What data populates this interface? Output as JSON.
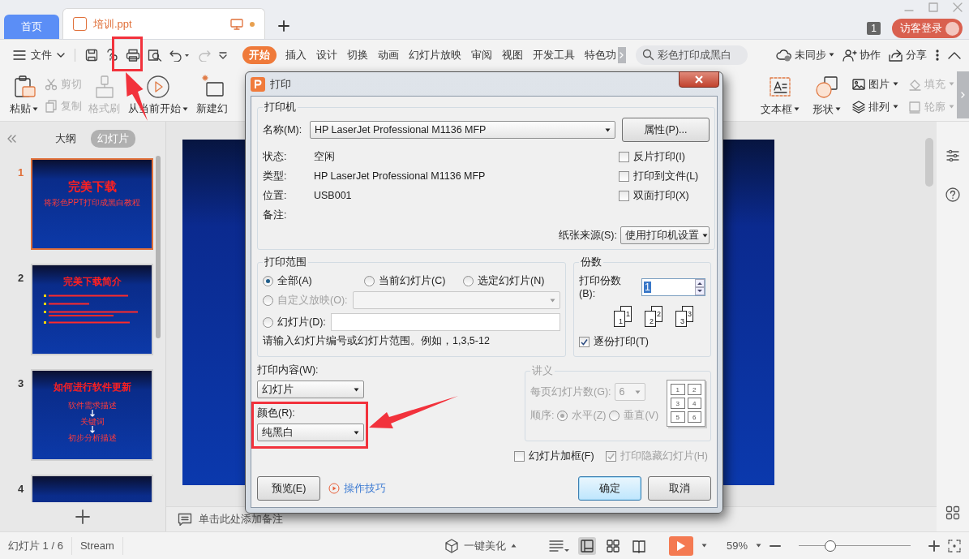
{
  "app_tabs": [
    {
      "label": "首页",
      "selected": false
    },
    {
      "label": "培训.ppt",
      "selected": true,
      "unsaved": true
    }
  ],
  "account": {
    "badge": "1",
    "login": "访客登录"
  },
  "file_menu": "文件",
  "ribbon_tabs": [
    {
      "label": "开始",
      "selected": true
    },
    {
      "label": "插入",
      "selected": false
    },
    {
      "label": "设计",
      "selected": false
    },
    {
      "label": "切换",
      "selected": false
    },
    {
      "label": "动画",
      "selected": false
    },
    {
      "label": "幻灯片放映",
      "selected": false
    },
    {
      "label": "审阅",
      "selected": false
    },
    {
      "label": "视图",
      "selected": false
    },
    {
      "label": "开发工具",
      "selected": false
    },
    {
      "label": "特色功",
      "selected": false
    }
  ],
  "search": {
    "placeholder": "彩色打印成黑白"
  },
  "top_actions": [
    {
      "label": "未同步",
      "kind": "cloud"
    },
    {
      "label": "协作",
      "kind": "person"
    },
    {
      "label": "分享",
      "kind": "share"
    }
  ],
  "ribbon_left": [
    {
      "label": "粘贴",
      "kind": "paste",
      "dropdown": true,
      "disabled": false
    },
    {
      "label": "剪切",
      "kind": "cut",
      "dropdown": false,
      "disabled": true
    },
    {
      "label": "复制",
      "kind": "copy",
      "dropdown": false,
      "disabled": true
    },
    {
      "label": "格式刷",
      "kind": "brush",
      "dropdown": false,
      "disabled": true
    },
    {
      "label": "从当前开始",
      "kind": "play",
      "dropdown": true,
      "disabled": false
    },
    {
      "label": "新建幻",
      "kind": "new",
      "dropdown": false,
      "disabled": false
    }
  ],
  "ribbon_right": [
    {
      "label": "文本框",
      "kind": "textbox",
      "dropdown": true,
      "disabled": false
    },
    {
      "label": "形状",
      "kind": "shape",
      "dropdown": true,
      "disabled": false
    },
    {
      "label": "图片",
      "kind": "picture",
      "dropdown": true,
      "disabled": false
    },
    {
      "label": "排列",
      "kind": "arrange",
      "dropdown": true,
      "disabled": false
    },
    {
      "label": "填充",
      "kind": "fill",
      "dropdown": true,
      "disabled": true
    },
    {
      "label": "轮廓",
      "kind": "outline",
      "dropdown": true,
      "disabled": true
    }
  ],
  "panel_tabs": [
    {
      "label": "大纲",
      "selected": false
    },
    {
      "label": "幻灯片",
      "selected": true
    }
  ],
  "slides": [
    {
      "number": "1",
      "selected": true,
      "kind": "title",
      "title": "完美下载",
      "lines": [
        "将彩色PPT打印成黑白教程"
      ]
    },
    {
      "number": "2",
      "selected": false,
      "kind": "bullets",
      "title": "完美下载简介"
    },
    {
      "number": "3",
      "selected": false,
      "kind": "flow",
      "title": "如何进行软件更新",
      "lines": [
        "软件需求描述",
        "关键词",
        "初步分析描述"
      ]
    },
    {
      "number": "4",
      "selected": false,
      "kind": "blank"
    }
  ],
  "notes": {
    "placeholder": "单击此处添加备注"
  },
  "status_bar": {
    "slide_info": "幻灯片 1 / 6",
    "theme": "Stream",
    "beautify": "一键美化",
    "zoom": "59%",
    "zoom_slider": {
      "level": 0.28
    },
    "views": [
      {
        "kind": "normal",
        "selected": true
      },
      {
        "kind": "sorter",
        "selected": false
      },
      {
        "kind": "reading",
        "selected": false
      }
    ]
  },
  "dialog": {
    "title": "打印",
    "printer": {
      "legend": "打印机",
      "name_label": "名称(M):",
      "name": "HP LaserJet Professional M1136 MFP",
      "properties_button": "属性(P)...",
      "info": [
        {
          "label": "状态:",
          "value": "空闲"
        },
        {
          "label": "类型:",
          "value": "HP LaserJet Professional M1136 MFP"
        },
        {
          "label": "位置:",
          "value": "USB001"
        },
        {
          "label": "备注:"
        }
      ],
      "options": [
        {
          "label": "反片打印(I)",
          "checked": false
        },
        {
          "label": "打印到文件(L)",
          "checked": false
        },
        {
          "label": "双面打印(X)",
          "checked": false
        }
      ],
      "paper_label": "纸张来源(S):",
      "paper_source": "使用打印机设置"
    },
    "range": {
      "legend": "打印范围",
      "options": [
        {
          "label": "全部(A)",
          "selected": true,
          "disabled": false,
          "kind": "plain"
        },
        {
          "label": "当前幻灯片(C)",
          "selected": false,
          "disabled": false,
          "kind": "plain"
        },
        {
          "label": "选定幻灯片(N)",
          "selected": false,
          "disabled": false,
          "kind": "plain"
        },
        {
          "label": "自定义放映(O):",
          "selected": false,
          "disabled": true,
          "kind": "dropdown"
        },
        {
          "label": "幻灯片(D):",
          "selected": false,
          "disabled": false,
          "kind": "input"
        }
      ],
      "hint": "请输入幻灯片编号或幻灯片范围。例如，1,3,5-12"
    },
    "copies": {
      "legend": "份数",
      "label": "打印份数(B):",
      "value": "1",
      "stacks": [
        {
          "front": "1",
          "back": "1"
        },
        {
          "front": "2",
          "back": "2"
        },
        {
          "front": "3",
          "back": "3"
        }
      ],
      "collate": {
        "label": "逐份打印(T)",
        "checked": true
      }
    },
    "content": {
      "label": "打印内容(W):",
      "value": "幻灯片"
    },
    "color": {
      "label": "颜色(R):",
      "value": "纯黑白"
    },
    "handout": {
      "legend": "讲义",
      "disabled": true,
      "per_page_label": "每页幻灯片数(G):",
      "per_page": "6",
      "order_label": "顺序:",
      "orders": [
        {
          "label": "水平(Z)",
          "selected": true
        },
        {
          "label": "垂直(V)",
          "selected": false
        }
      ],
      "cells": [
        "1",
        "2",
        "3",
        "4",
        "5",
        "6"
      ]
    },
    "extra": [
      {
        "label": "幻灯片加框(F)",
        "checked": false,
        "disabled": false
      },
      {
        "label": "打印隐藏幻灯片(H)",
        "checked": true,
        "disabled": true
      }
    ],
    "preview_button": "预览(E)",
    "tips_link": "操作技巧",
    "ok_button": "确定",
    "cancel_button": "取消"
  }
}
